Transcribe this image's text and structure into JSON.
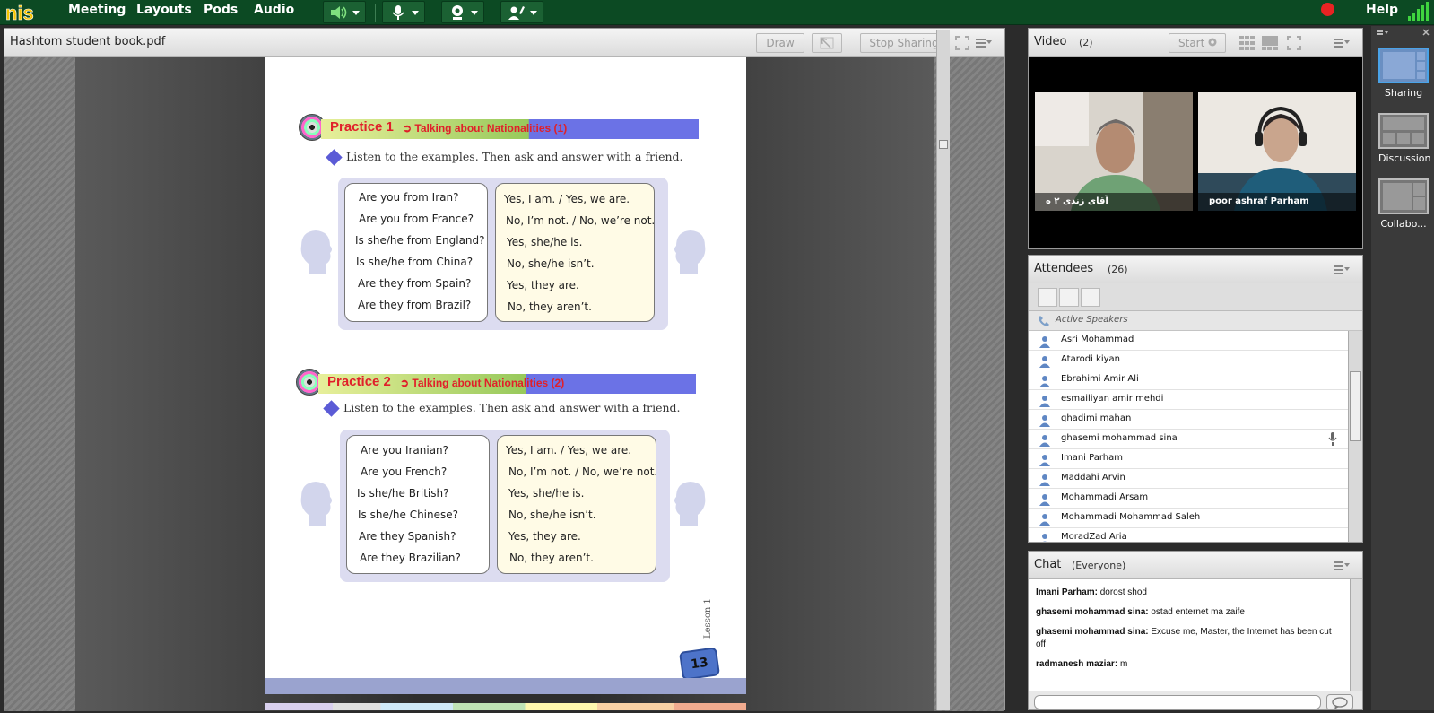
{
  "topbar": {
    "logo_text": "nis",
    "menus": [
      "Meeting",
      "Layouts",
      "Pods",
      "Audio"
    ],
    "help": "Help"
  },
  "share": {
    "title": "Hashtom student book.pdf",
    "draw": "Draw",
    "stop_sharing": "Stop Sharing"
  },
  "page": {
    "practice1_title": "Practice 1",
    "practice1_sub": "Talking about Nationalities (1)",
    "practice1_instr": "Listen to the examples. Then ask and answer with a friend.",
    "practice1_questions": [
      "Are you from Iran?",
      "Are you from France?",
      "Is she/he from England?",
      "Is she/he from China?",
      "Are they from Spain?",
      "Are they from Brazil?"
    ],
    "practice1_answers": [
      "Yes, I am. / Yes, we are.",
      "No, I’m not. / No, we’re not.",
      "Yes, she/he is.",
      "No, she/he isn’t.",
      "Yes, they are.",
      "No, they aren’t."
    ],
    "practice2_title": "Practice 2",
    "practice2_sub": "Talking about Nationalities (2)",
    "practice2_instr": "Listen to the examples. Then ask and answer with a friend.",
    "practice2_questions": [
      "Are you Iranian?",
      "Are you French?",
      "Is she/he British?",
      "Is she/he Chinese?",
      "Are they Spanish?",
      "Are they Brazilian?"
    ],
    "practice2_answers": [
      "Yes, I am. / Yes, we are.",
      "No, I’m not. / No, we’re not.",
      "Yes, she/he is.",
      "No, she/he isn’t.",
      "Yes, they are.",
      "No, they aren’t."
    ],
    "lesson": "Lesson 1",
    "page_number": "13"
  },
  "video": {
    "title": "Video",
    "count": "(2)",
    "start": "Start",
    "tiles": [
      "ﺁﻗﺎﯼ ﺯﻧﺪﯼ ۲ ﻩ",
      "poor ashraf Parham"
    ]
  },
  "attendees": {
    "title": "Attendees",
    "count": "(26)",
    "active_speakers": "Active Speakers",
    "list": [
      "Asri Mohammad",
      "Atarodi kiyan",
      "Ebrahimi Amir Ali",
      "esmailiyan amir mehdi",
      "ghadimi mahan",
      "ghasemi mohammad sina",
      "Imani Parham",
      "Maddahi Arvin",
      "Mohammadi Arsam",
      "Mohammadi Mohammad Saleh",
      "MoradZad Aria"
    ]
  },
  "chat": {
    "title": "Chat",
    "scope": "(Everyone)",
    "messages": [
      {
        "who": "Imani Parham:",
        "text": "dorost shod"
      },
      {
        "who": "ghasemi mohammad sina:",
        "text": "ostad enternet ma zaife"
      },
      {
        "who": "ghasemi mohammad sina:",
        "text": "Excuse me, Master, the Internet has been cut off"
      },
      {
        "who": "radmanesh maziar:",
        "text": "m"
      }
    ]
  },
  "layouts": {
    "items": [
      "Sharing",
      "Discussion",
      "Collabo..."
    ]
  },
  "colors": {
    "topbar": "#0c4a23",
    "accent_blue": "#4aa3e8",
    "practice_red": "#e0202a",
    "record_red": "#e82323"
  }
}
